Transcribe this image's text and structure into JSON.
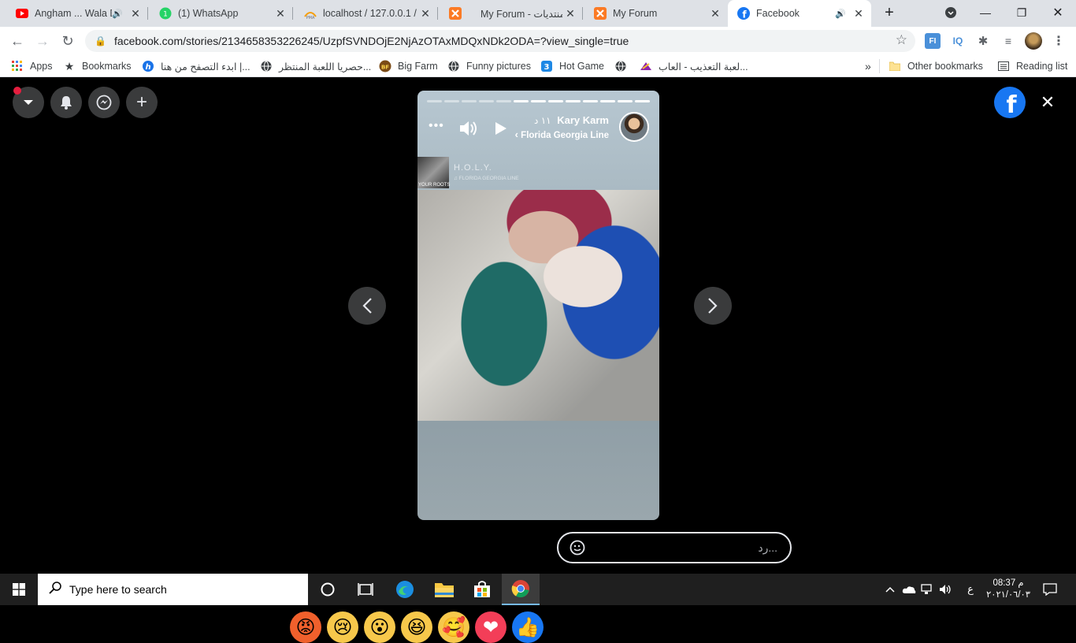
{
  "tabs": [
    {
      "title": "Angham ... Wala D",
      "favicon": "youtube-icon",
      "audio": true
    },
    {
      "title": "(1) WhatsApp",
      "favicon": "whatsapp-icon",
      "audio": false
    },
    {
      "title": "localhost / 127.0.0.1 /",
      "favicon": "phpmyadmin-icon",
      "audio": false
    },
    {
      "title": "My Forum - منتديات",
      "favicon": "xampp-icon",
      "audio": false
    },
    {
      "title": "My Forum",
      "favicon": "xampp-icon",
      "audio": false
    },
    {
      "title": "Facebook",
      "favicon": "facebook-icon",
      "audio": true,
      "active": true
    }
  ],
  "toolbar": {
    "url": "facebook.com/stories/2134658353226245/UzpfSVNDOjE2NjAzOTAxMDQxNDk2ODA=?view_single=true"
  },
  "bookmarks": {
    "apps": "Apps",
    "bookmarks": "Bookmarks",
    "items": [
      {
        "label": "ابدء التصفح من هنا |...",
        "icon": "h-icon"
      },
      {
        "label": "حصريا اللعبة المنتظر...",
        "icon": "globe-icon"
      },
      {
        "label": "Big Farm",
        "icon": "bigfarm-icon"
      },
      {
        "label": "Funny pictures",
        "icon": "globe-icon"
      },
      {
        "label": "Hot Game",
        "icon": "game-icon"
      },
      {
        "label": "",
        "icon": "globe-icon"
      },
      {
        "label": "لعبة التعذيب - العاب...",
        "icon": "torture-game-icon"
      }
    ],
    "overflow": "»",
    "other": "Other bookmarks",
    "reading": "Reading list"
  },
  "story": {
    "author": "Kary Karm",
    "time": "١١ د",
    "music": "Florida Georgia Line",
    "music_title": "H.O.L.Y.",
    "music_artist": "♫ FLORIDA GEORGIA LINE",
    "album_text": "YOUR ROOTS",
    "segments_total": 13,
    "segments_done": 5
  },
  "reply": {
    "placeholder": "رد..."
  },
  "reactions": [
    "angry",
    "sad",
    "wow",
    "haha",
    "care",
    "love",
    "like"
  ],
  "taskbar": {
    "search_placeholder": "Type here to search",
    "lang": "ع",
    "time": "08:37 م",
    "date": "٢٠٢١/٠٦/٠٣"
  }
}
